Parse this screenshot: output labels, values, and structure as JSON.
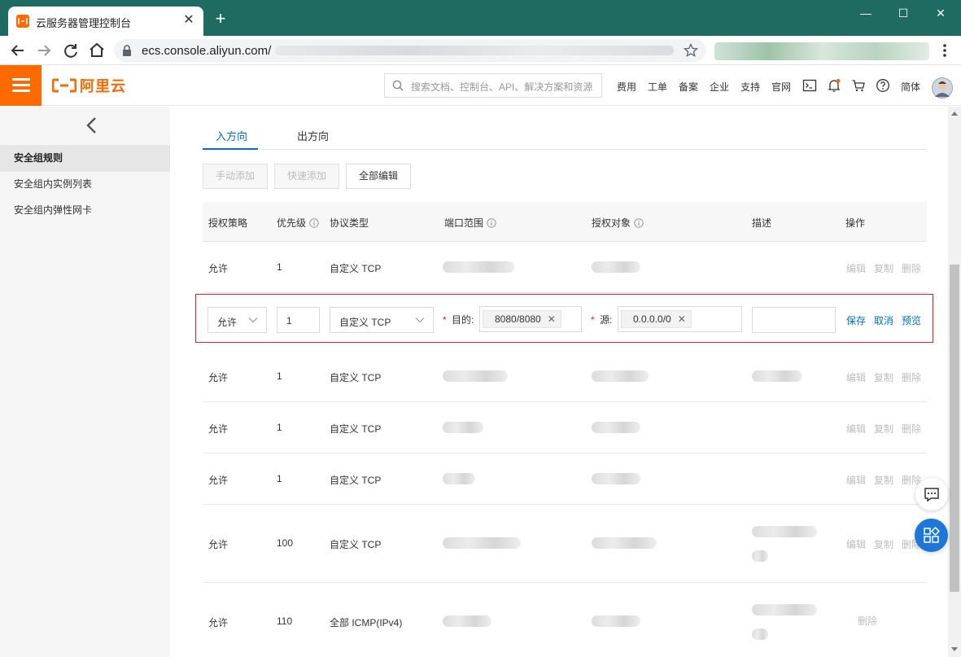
{
  "browser": {
    "tab_title": "云服务器管理控制台",
    "url_host": "ecs.console.aliyun.com/"
  },
  "topbar": {
    "logo_text": "阿里云",
    "search_placeholder": "搜索文档、控制台、API、解决方案和资源",
    "links": [
      "费用",
      "工单",
      "备案",
      "企业",
      "支持",
      "官网"
    ],
    "language": "简体"
  },
  "sidebar": {
    "items": [
      {
        "label": "安全组规则",
        "active": true
      },
      {
        "label": "安全组内实例列表",
        "active": false
      },
      {
        "label": "安全组内弹性网卡",
        "active": false
      }
    ]
  },
  "tabs": [
    "入方向",
    "出方向"
  ],
  "toolbar": {
    "manual_add": "手动添加",
    "quick_add": "快速添加",
    "edit_all": "全部编辑"
  },
  "table": {
    "headers": [
      "授权策略",
      "优先级",
      "协议类型",
      "端口范围",
      "授权对象",
      "描述",
      "操作"
    ],
    "rows": [
      {
        "policy": "允许",
        "priority": "1",
        "protocol": "自定义 TCP",
        "actions": [
          "编辑",
          "复制",
          "删除"
        ]
      },
      {
        "policy": "允许",
        "priority": "1",
        "protocol": "自定义 TCP",
        "actions": [
          "编辑",
          "复制",
          "删除"
        ]
      },
      {
        "policy": "允许",
        "priority": "1",
        "protocol": "自定义 TCP",
        "actions": [
          "编辑",
          "复制",
          "删除"
        ]
      },
      {
        "policy": "允许",
        "priority": "1",
        "protocol": "自定义 TCP",
        "actions": [
          "编辑",
          "复制",
          "删除"
        ]
      },
      {
        "policy": "允许",
        "priority": "100",
        "protocol": "自定义 TCP",
        "actions": [
          "编辑",
          "复制",
          "删除"
        ]
      },
      {
        "policy": "允许",
        "priority": "110",
        "protocol": "全部 ICMP(IPv4)",
        "actions": [
          "删除"
        ]
      }
    ]
  },
  "edit_row": {
    "policy": "允许",
    "priority": "1",
    "protocol": "自定义 TCP",
    "dest_label": "目的",
    "dest_tag": "8080/8080",
    "source_label": "源",
    "source_tag": "0.0.0.0/0",
    "description": "",
    "save": "保存",
    "cancel": "取消",
    "preview": "预览"
  },
  "colors": {
    "brand_orange": "#ff6a00",
    "chrome_green": "#1f6b62",
    "link_blue": "#0070cc",
    "highlight_red": "#d9262c"
  }
}
